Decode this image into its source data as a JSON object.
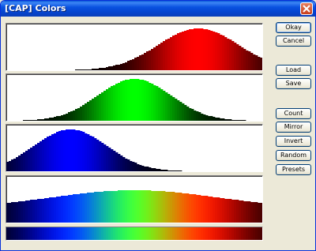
{
  "window": {
    "title": "[CAP] Colors"
  },
  "buttons": {
    "okay": "Okay",
    "cancel": "Cancel",
    "load": "Load",
    "save": "Save",
    "count": "Count",
    "mirror": "Mirror",
    "invert": "Invert",
    "random": "Random",
    "presets": "Presets"
  },
  "channels": [
    {
      "name": "red",
      "color": "#ff0000",
      "center": 0.75,
      "width": 0.21
    },
    {
      "name": "green",
      "color": "#00ff00",
      "center": 0.5,
      "width": 0.19
    },
    {
      "name": "blue",
      "color": "#0000ff",
      "center": 0.25,
      "width": 0.19
    }
  ],
  "colors": {
    "titlebar": "#0a52e0",
    "face": "#ece9d8",
    "button_border": "#003c74"
  }
}
